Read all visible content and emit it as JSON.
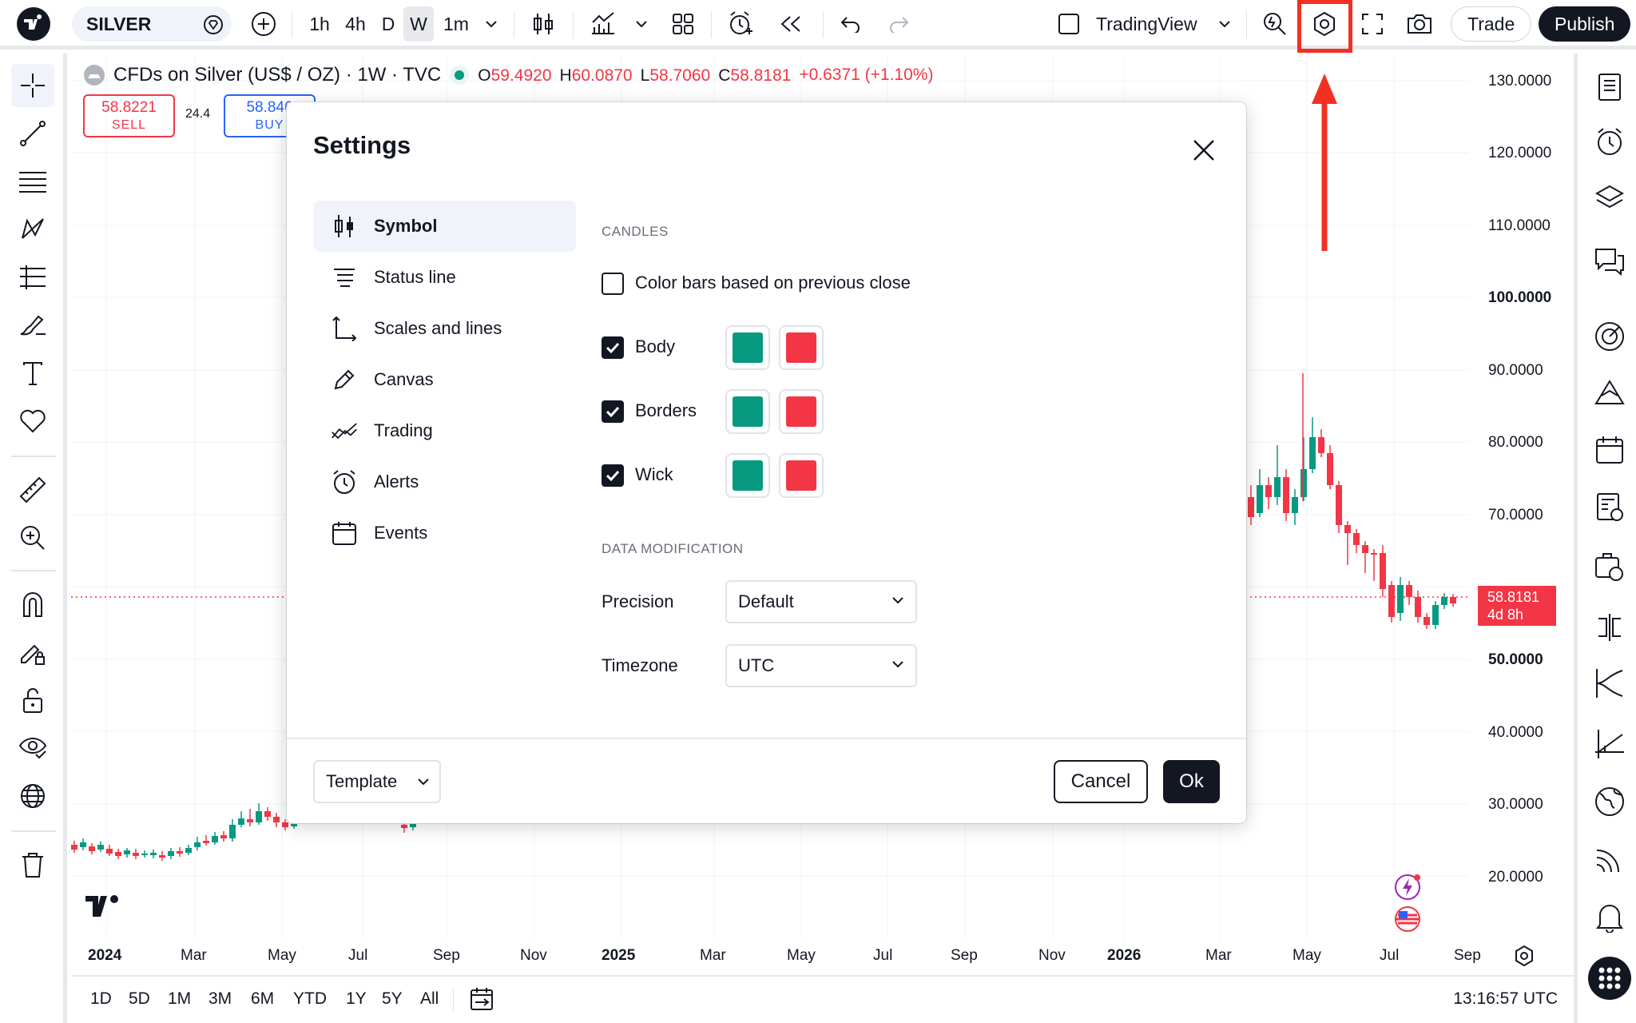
{
  "top_toolbar": {
    "symbol": "SILVER",
    "timeframes": [
      "1h",
      "4h",
      "D",
      "W",
      "1m"
    ],
    "selected_timeframe": "W",
    "layout_name": "TradingView",
    "trade_label": "Trade",
    "publish_label": "Publish"
  },
  "legend": {
    "title": "CFDs on Silver (US$ / OZ) · 1W · TVC",
    "open_key": "O",
    "open": "59.4920",
    "high_key": "H",
    "high": "60.0870",
    "low_key": "L",
    "low": "58.7060",
    "close_key": "C",
    "close": "58.8181",
    "change": "+0.6371 (+1.10%)",
    "sell_price": "58.8221",
    "sell_label": "SELL",
    "spread": "24.4",
    "buy_price": "58.846",
    "buy_label": "BUY"
  },
  "price_scale": {
    "labels": [
      "130.0000",
      "120.0000",
      "110.0000",
      "100.0000",
      "90.0000",
      "80.0000",
      "70.0000",
      "50.0000",
      "40.0000",
      "30.0000",
      "20.0000"
    ],
    "current_price": "58.8181",
    "countdown": "4d 8h"
  },
  "time_axis": {
    "labels": [
      "2024",
      "Mar",
      "May",
      "Jul",
      "Sep",
      "Nov",
      "2025",
      "Mar",
      "May",
      "Jul",
      "Sep",
      "Nov",
      "2026",
      "Mar",
      "May",
      "Jul",
      "Sep"
    ]
  },
  "bottom_bar": {
    "ranges": [
      "1D",
      "5D",
      "1M",
      "3M",
      "6M",
      "YTD",
      "1Y",
      "5Y",
      "All"
    ],
    "clock": "13:16:57 UTC"
  },
  "settings_dialog": {
    "title": "Settings",
    "nav": [
      {
        "label": "Symbol",
        "icon": "candles-icon"
      },
      {
        "label": "Status line",
        "icon": "status-line-icon"
      },
      {
        "label": "Scales and lines",
        "icon": "scales-icon"
      },
      {
        "label": "Canvas",
        "icon": "pencil-icon"
      },
      {
        "label": "Trading",
        "icon": "trading-icon"
      },
      {
        "label": "Alerts",
        "icon": "alarm-icon"
      },
      {
        "label": "Events",
        "icon": "calendar-icon"
      }
    ],
    "active_nav": "Symbol",
    "candles_heading": "CANDLES",
    "color_bars_label": "Color bars based on previous close",
    "color_bars_checked": false,
    "rows": [
      {
        "label": "Body",
        "checked": true
      },
      {
        "label": "Borders",
        "checked": true
      },
      {
        "label": "Wick",
        "checked": true
      }
    ],
    "up_color": "#089981",
    "down_color": "#f23645",
    "data_mod_heading": "DATA MODIFICATION",
    "precision_label": "Precision",
    "precision_value": "Default",
    "timezone_label": "Timezone",
    "timezone_value": "UTC",
    "template_label": "Template",
    "cancel_label": "Cancel",
    "ok_label": "Ok"
  },
  "colors": {
    "up": "#089981",
    "down": "#f23645",
    "annotation_red": "#f23022",
    "dark": "#131722"
  }
}
